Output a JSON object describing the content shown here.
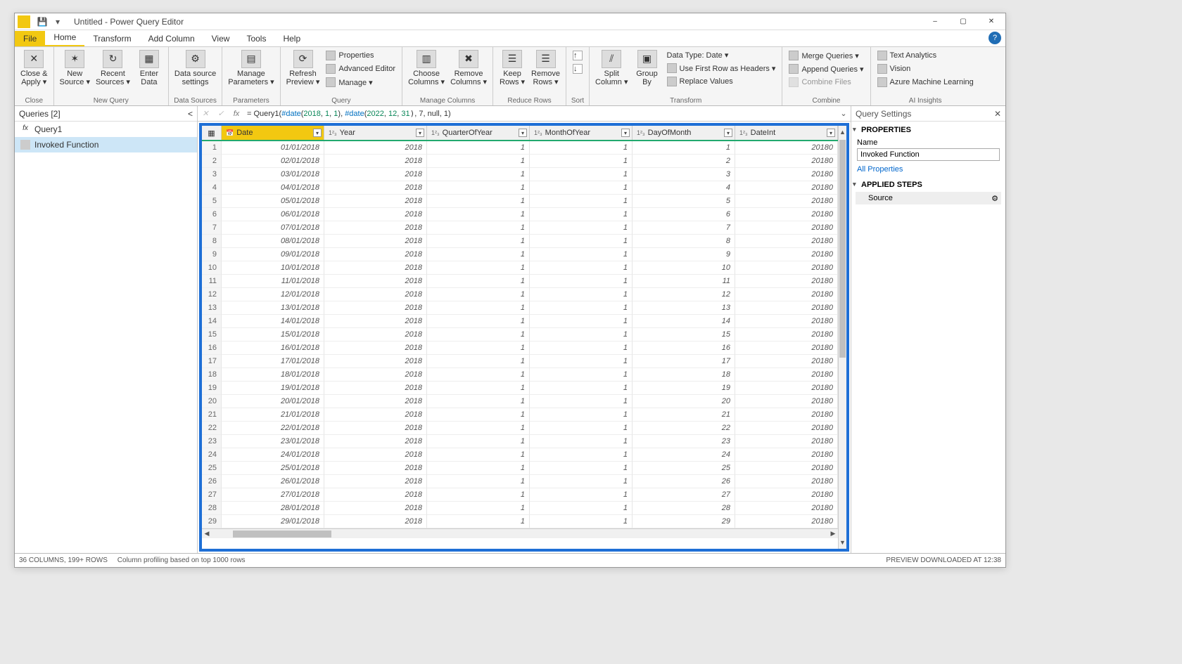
{
  "title": "Untitled - Power Query Editor",
  "tabs": {
    "file": "File",
    "home": "Home",
    "transform": "Transform",
    "addcol": "Add Column",
    "view": "View",
    "tools": "Tools",
    "help": "Help"
  },
  "ribbon": {
    "close": {
      "label1": "Close &",
      "label2": "Apply ▾",
      "group": "Close"
    },
    "newquery": {
      "newsource1": "New",
      "newsource2": "Source ▾",
      "recent1": "Recent",
      "recent2": "Sources ▾",
      "enter1": "Enter",
      "enter2": "Data",
      "group": "New Query"
    },
    "datasources": {
      "label1": "Data source",
      "label2": "settings",
      "group": "Data Sources"
    },
    "parameters": {
      "label1": "Manage",
      "label2": "Parameters ▾",
      "group": "Parameters"
    },
    "query": {
      "refresh1": "Refresh",
      "refresh2": "Preview ▾",
      "prop": "Properties",
      "adv": "Advanced Editor",
      "manage": "Manage ▾",
      "group": "Query"
    },
    "managecols": {
      "choose1": "Choose",
      "choose2": "Columns ▾",
      "remove1": "Remove",
      "remove2": "Columns ▾",
      "group": "Manage Columns"
    },
    "reducerows": {
      "keep1": "Keep",
      "keep2": "Rows ▾",
      "remove1": "Remove",
      "remove2": "Rows ▾",
      "group": "Reduce Rows"
    },
    "sort": {
      "group": "Sort"
    },
    "transform": {
      "split1": "Split",
      "split2": "Column ▾",
      "group1": "Group",
      "group2": "By",
      "datatype": "Data Type: Date ▾",
      "firstrow": "Use First Row as Headers ▾",
      "replace": "Replace Values",
      "group": "Transform"
    },
    "combine": {
      "merge": "Merge Queries ▾",
      "append": "Append Queries ▾",
      "files": "Combine Files",
      "group": "Combine"
    },
    "ai": {
      "text": "Text Analytics",
      "vision": "Vision",
      "ml": "Azure Machine Learning",
      "group": "AI Insights"
    }
  },
  "queries": {
    "header": "Queries [2]",
    "q1": "Query1",
    "q2": "Invoked Function"
  },
  "formula": {
    "prefix": "= Query1(",
    "d1a": "#date",
    "d1p": "(",
    "y1": "2018",
    "c": ", ",
    "m1": "1",
    "d1": "1",
    "cp": "), ",
    "d2a": "#date",
    "y2": "2022",
    "m2": "12",
    "d2": "31",
    "tail": ", 7, null, 1)"
  },
  "columns": {
    "date": "Date",
    "year": "Year",
    "quarter": "QuarterOfYear",
    "month": "MonthOfYear",
    "day": "DayOfMonth",
    "dateint": "DateInt"
  },
  "rows": [
    {
      "idx": 1,
      "date": "01/01/2018",
      "year": "2018",
      "q": "1",
      "m": "1",
      "d": "1",
      "di": "20180"
    },
    {
      "idx": 2,
      "date": "02/01/2018",
      "year": "2018",
      "q": "1",
      "m": "1",
      "d": "2",
      "di": "20180"
    },
    {
      "idx": 3,
      "date": "03/01/2018",
      "year": "2018",
      "q": "1",
      "m": "1",
      "d": "3",
      "di": "20180"
    },
    {
      "idx": 4,
      "date": "04/01/2018",
      "year": "2018",
      "q": "1",
      "m": "1",
      "d": "4",
      "di": "20180"
    },
    {
      "idx": 5,
      "date": "05/01/2018",
      "year": "2018",
      "q": "1",
      "m": "1",
      "d": "5",
      "di": "20180"
    },
    {
      "idx": 6,
      "date": "06/01/2018",
      "year": "2018",
      "q": "1",
      "m": "1",
      "d": "6",
      "di": "20180"
    },
    {
      "idx": 7,
      "date": "07/01/2018",
      "year": "2018",
      "q": "1",
      "m": "1",
      "d": "7",
      "di": "20180"
    },
    {
      "idx": 8,
      "date": "08/01/2018",
      "year": "2018",
      "q": "1",
      "m": "1",
      "d": "8",
      "di": "20180"
    },
    {
      "idx": 9,
      "date": "09/01/2018",
      "year": "2018",
      "q": "1",
      "m": "1",
      "d": "9",
      "di": "20180"
    },
    {
      "idx": 10,
      "date": "10/01/2018",
      "year": "2018",
      "q": "1",
      "m": "1",
      "d": "10",
      "di": "20180"
    },
    {
      "idx": 11,
      "date": "11/01/2018",
      "year": "2018",
      "q": "1",
      "m": "1",
      "d": "11",
      "di": "20180"
    },
    {
      "idx": 12,
      "date": "12/01/2018",
      "year": "2018",
      "q": "1",
      "m": "1",
      "d": "12",
      "di": "20180"
    },
    {
      "idx": 13,
      "date": "13/01/2018",
      "year": "2018",
      "q": "1",
      "m": "1",
      "d": "13",
      "di": "20180"
    },
    {
      "idx": 14,
      "date": "14/01/2018",
      "year": "2018",
      "q": "1",
      "m": "1",
      "d": "14",
      "di": "20180"
    },
    {
      "idx": 15,
      "date": "15/01/2018",
      "year": "2018",
      "q": "1",
      "m": "1",
      "d": "15",
      "di": "20180"
    },
    {
      "idx": 16,
      "date": "16/01/2018",
      "year": "2018",
      "q": "1",
      "m": "1",
      "d": "16",
      "di": "20180"
    },
    {
      "idx": 17,
      "date": "17/01/2018",
      "year": "2018",
      "q": "1",
      "m": "1",
      "d": "17",
      "di": "20180"
    },
    {
      "idx": 18,
      "date": "18/01/2018",
      "year": "2018",
      "q": "1",
      "m": "1",
      "d": "18",
      "di": "20180"
    },
    {
      "idx": 19,
      "date": "19/01/2018",
      "year": "2018",
      "q": "1",
      "m": "1",
      "d": "19",
      "di": "20180"
    },
    {
      "idx": 20,
      "date": "20/01/2018",
      "year": "2018",
      "q": "1",
      "m": "1",
      "d": "20",
      "di": "20180"
    },
    {
      "idx": 21,
      "date": "21/01/2018",
      "year": "2018",
      "q": "1",
      "m": "1",
      "d": "21",
      "di": "20180"
    },
    {
      "idx": 22,
      "date": "22/01/2018",
      "year": "2018",
      "q": "1",
      "m": "1",
      "d": "22",
      "di": "20180"
    },
    {
      "idx": 23,
      "date": "23/01/2018",
      "year": "2018",
      "q": "1",
      "m": "1",
      "d": "23",
      "di": "20180"
    },
    {
      "idx": 24,
      "date": "24/01/2018",
      "year": "2018",
      "q": "1",
      "m": "1",
      "d": "24",
      "di": "20180"
    },
    {
      "idx": 25,
      "date": "25/01/2018",
      "year": "2018",
      "q": "1",
      "m": "1",
      "d": "25",
      "di": "20180"
    },
    {
      "idx": 26,
      "date": "26/01/2018",
      "year": "2018",
      "q": "1",
      "m": "1",
      "d": "26",
      "di": "20180"
    },
    {
      "idx": 27,
      "date": "27/01/2018",
      "year": "2018",
      "q": "1",
      "m": "1",
      "d": "27",
      "di": "20180"
    },
    {
      "idx": 28,
      "date": "28/01/2018",
      "year": "2018",
      "q": "1",
      "m": "1",
      "d": "28",
      "di": "20180"
    },
    {
      "idx": 29,
      "date": "29/01/2018",
      "year": "2018",
      "q": "1",
      "m": "1",
      "d": "29",
      "di": "20180"
    }
  ],
  "settings": {
    "header": "Query Settings",
    "props": "PROPERTIES",
    "nameLabel": "Name",
    "nameValue": "Invoked Function",
    "allprops": "All Properties",
    "steps": "APPLIED STEPS",
    "step1": "Source"
  },
  "status": {
    "left1": "36 COLUMNS, 199+ ROWS",
    "left2": "Column profiling based on top 1000 rows",
    "right": "PREVIEW DOWNLOADED AT 12:38"
  }
}
